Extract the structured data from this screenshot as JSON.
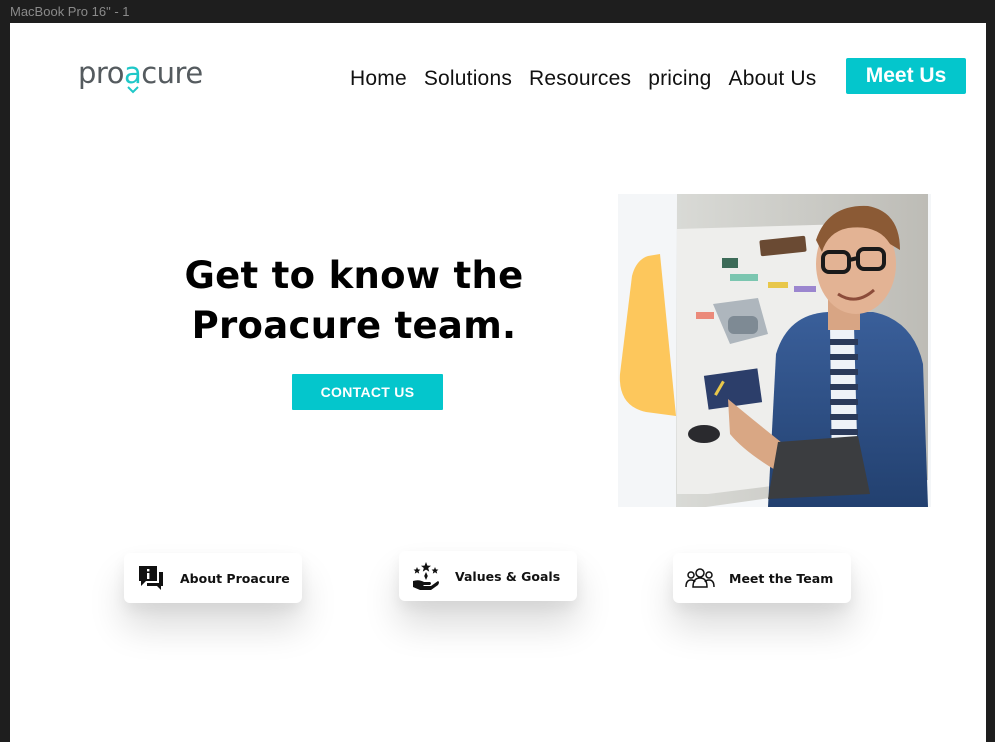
{
  "frame": {
    "label": "MacBook Pro 16\" - 1"
  },
  "header": {
    "logo": {
      "prefix": "pro",
      "accent": "a",
      "suffix": "cure"
    },
    "nav": [
      {
        "label": "Home"
      },
      {
        "label": "Solutions"
      },
      {
        "label": "Resources"
      },
      {
        "label": "pricing"
      },
      {
        "label": "About Us"
      }
    ],
    "cta_label": "Meet Us"
  },
  "hero": {
    "title_line1": "Get to know the",
    "title_line2": "Proacure team.",
    "button_label": "CONTACT US"
  },
  "cards": [
    {
      "label": "About Proacure",
      "icon": "chat-info-icon"
    },
    {
      "label": "Values & Goals",
      "icon": "hand-stars-icon"
    },
    {
      "label": "Meet the Team",
      "icon": "team-icon"
    }
  ],
  "colors": {
    "accent": "#04c6cc",
    "yellow": "#fdc75c",
    "frame": "#1e1e1e"
  }
}
